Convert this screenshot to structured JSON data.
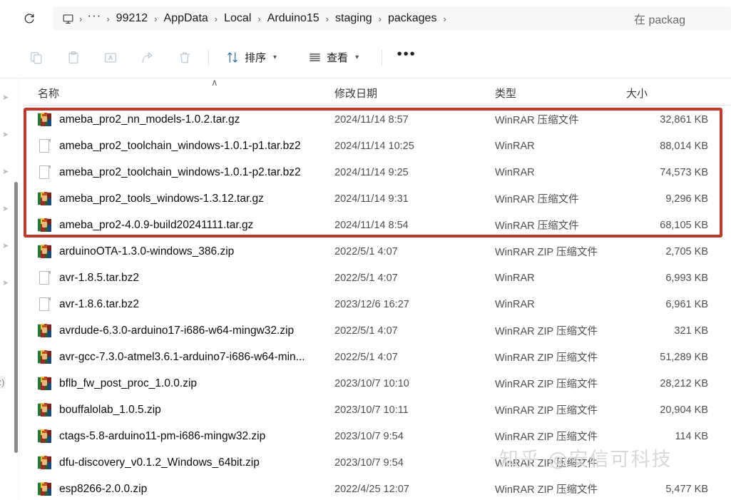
{
  "window": {
    "addressbar": {
      "refresh_icon": "refresh-icon",
      "pc_icon": "this-pc-icon",
      "overflow_label": "···",
      "crumbs": [
        "99212",
        "AppData",
        "Local",
        "Arduino15",
        "staging",
        "packages"
      ],
      "separator": "›",
      "search_value": "在 packag"
    },
    "commandbar": {
      "icons": [
        {
          "name": "copy-icon",
          "glyph": "copy"
        },
        {
          "name": "paste-icon",
          "glyph": "paste"
        },
        {
          "name": "rename-icon",
          "glyph": "rename"
        },
        {
          "name": "share-icon",
          "glyph": "share"
        },
        {
          "name": "delete-icon",
          "glyph": "trash"
        }
      ],
      "sort_label": "排序",
      "view_label": "查看",
      "chevron": "⌄",
      "overflow_label": "•••"
    },
    "columns": {
      "name": "名称",
      "date": "修改日期",
      "type": "类型",
      "size": "大小",
      "sort_indicator": "∧"
    },
    "annotation": {
      "color": "#c0392b",
      "highlighted_row_count": 5
    },
    "watermark": "知乎 @安信可科技"
  },
  "files": [
    {
      "icon": "winrar-archive-icon",
      "name": "ameba_pro2_nn_models-1.0.2.tar.gz",
      "date": "2024/11/14 8:57",
      "type": "WinRAR 压缩文件",
      "size": "32,861 KB",
      "highlighted": true
    },
    {
      "icon": "file-icon",
      "name": "ameba_pro2_toolchain_windows-1.0.1-p1.tar.bz2",
      "date": "2024/11/14 10:25",
      "type": "WinRAR",
      "size": "88,014 KB",
      "highlighted": true
    },
    {
      "icon": "file-icon",
      "name": "ameba_pro2_toolchain_windows-1.0.1-p2.tar.bz2",
      "date": "2024/11/14 9:25",
      "type": "WinRAR",
      "size": "74,573 KB",
      "highlighted": true
    },
    {
      "icon": "winrar-archive-icon",
      "name": "ameba_pro2_tools_windows-1.3.12.tar.gz",
      "date": "2024/11/14 9:31",
      "type": "WinRAR 压缩文件",
      "size": "9,296 KB",
      "highlighted": true
    },
    {
      "icon": "winrar-archive-icon",
      "name": "ameba_pro2-4.0.9-build20241111.tar.gz",
      "date": "2024/11/14 8:54",
      "type": "WinRAR 压缩文件",
      "size": "68,105 KB",
      "highlighted": true
    },
    {
      "icon": "winrar-archive-icon",
      "name": "arduinoOTA-1.3.0-windows_386.zip",
      "date": "2022/5/1 4:07",
      "type": "WinRAR ZIP 压缩文件",
      "size": "2,705 KB",
      "highlighted": false
    },
    {
      "icon": "file-icon",
      "name": "avr-1.8.5.tar.bz2",
      "date": "2022/5/1 4:07",
      "type": "WinRAR",
      "size": "6,993 KB",
      "highlighted": false
    },
    {
      "icon": "file-icon",
      "name": "avr-1.8.6.tar.bz2",
      "date": "2023/12/6 16:27",
      "type": "WinRAR",
      "size": "6,961 KB",
      "highlighted": false
    },
    {
      "icon": "winrar-archive-icon",
      "name": "avrdude-6.3.0-arduino17-i686-w64-mingw32.zip",
      "date": "2022/5/1 4:07",
      "type": "WinRAR ZIP 压缩文件",
      "size": "321 KB",
      "highlighted": false
    },
    {
      "icon": "winrar-archive-icon",
      "name": "avr-gcc-7.3.0-atmel3.6.1-arduino7-i686-w64-min...",
      "date": "2022/5/1 4:07",
      "type": "WinRAR ZIP 压缩文件",
      "size": "51,289 KB",
      "highlighted": false
    },
    {
      "icon": "winrar-archive-icon",
      "name": "bflb_fw_post_proc_1.0.0.zip",
      "date": "2023/10/7 10:10",
      "type": "WinRAR ZIP 压缩文件",
      "size": "28,212 KB",
      "highlighted": false
    },
    {
      "icon": "winrar-archive-icon",
      "name": "bouffalolab_1.0.5.zip",
      "date": "2023/10/7 10:11",
      "type": "WinRAR ZIP 压缩文件",
      "size": "20,904 KB",
      "highlighted": false
    },
    {
      "icon": "winrar-archive-icon",
      "name": "ctags-5.8-arduino11-pm-i686-mingw32.zip",
      "date": "2023/10/7 9:54",
      "type": "WinRAR ZIP 压缩文件",
      "size": "114 KB",
      "highlighted": false
    },
    {
      "icon": "winrar-archive-icon",
      "name": "dfu-discovery_v0.1.2_Windows_64bit.zip",
      "date": "2023/10/7 9:54",
      "type": "WinRAR ZIP 压缩文件",
      "size": "",
      "highlighted": false
    },
    {
      "icon": "winrar-archive-icon",
      "name": "esp8266-2.0.0.zip",
      "date": "2022/4/25 12:07",
      "type": "WinRAR ZIP 压缩文件",
      "size": "5,477 KB",
      "highlighted": false
    }
  ]
}
